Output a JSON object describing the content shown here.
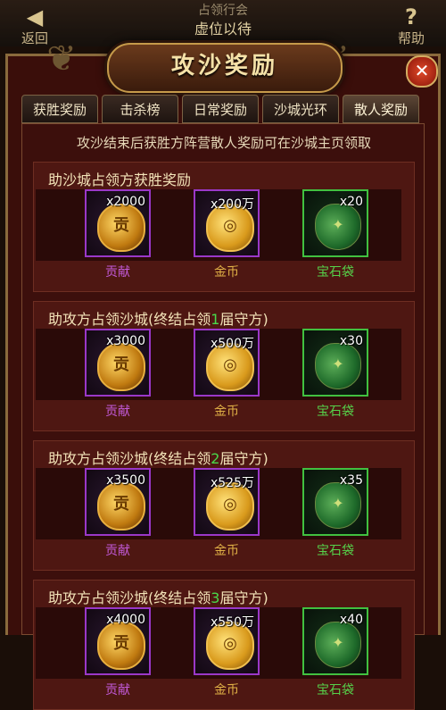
{
  "topbar": {
    "back_label": "返回",
    "back_icon": "back-arrow-icon",
    "help_label": "帮助",
    "help_icon": "question-icon",
    "line1": "占领行会",
    "line2": "虚位以待"
  },
  "panel": {
    "title": "攻沙奖励",
    "close_icon": "close-icon",
    "accent_color": "#c59a4a"
  },
  "tabs": [
    {
      "label": "获胜奖励",
      "active": false
    },
    {
      "label": "击杀榜",
      "active": false
    },
    {
      "label": "日常奖励",
      "active": false
    },
    {
      "label": "沙城光环",
      "active": false
    },
    {
      "label": "散人奖励",
      "active": true
    }
  ],
  "notice": "攻沙结束后获胜方阵营散人奖励可在沙城主页领取",
  "sections": [
    {
      "title_pre": "助沙城占领方获胜奖励",
      "title_num": "",
      "title_post": "",
      "items": [
        {
          "qty": "x2000",
          "name": "贡献",
          "icon": "contribution-medal-icon",
          "glyph": "贡"
        },
        {
          "qty": "x200万",
          "name": "金币",
          "icon": "gold-coin-icon",
          "glyph": "◎"
        },
        {
          "qty": "x20",
          "name": "宝石袋",
          "icon": "gem-bag-icon",
          "glyph": "✦"
        }
      ]
    },
    {
      "title_pre": "助攻方占领沙城(终结占领",
      "title_num": "1",
      "title_post": "届守方)",
      "items": [
        {
          "qty": "x3000",
          "name": "贡献",
          "icon": "contribution-medal-icon",
          "glyph": "贡"
        },
        {
          "qty": "x500万",
          "name": "金币",
          "icon": "gold-coin-icon",
          "glyph": "◎"
        },
        {
          "qty": "x30",
          "name": "宝石袋",
          "icon": "gem-bag-icon",
          "glyph": "✦"
        }
      ]
    },
    {
      "title_pre": "助攻方占领沙城(终结占领",
      "title_num": "2",
      "title_post": "届守方)",
      "items": [
        {
          "qty": "x3500",
          "name": "贡献",
          "icon": "contribution-medal-icon",
          "glyph": "贡"
        },
        {
          "qty": "x525万",
          "name": "金币",
          "icon": "gold-coin-icon",
          "glyph": "◎"
        },
        {
          "qty": "x35",
          "name": "宝石袋",
          "icon": "gem-bag-icon",
          "glyph": "✦"
        }
      ]
    },
    {
      "title_pre": "助攻方占领沙城(终结占领",
      "title_num": "3",
      "title_post": "届守方)",
      "items": [
        {
          "qty": "x4000",
          "name": "贡献",
          "icon": "contribution-medal-icon",
          "glyph": "贡"
        },
        {
          "qty": "x550万",
          "name": "金币",
          "icon": "gold-coin-icon",
          "glyph": "◎"
        },
        {
          "qty": "x40",
          "name": "宝石袋",
          "icon": "gem-bag-icon",
          "glyph": "✦"
        }
      ]
    }
  ]
}
